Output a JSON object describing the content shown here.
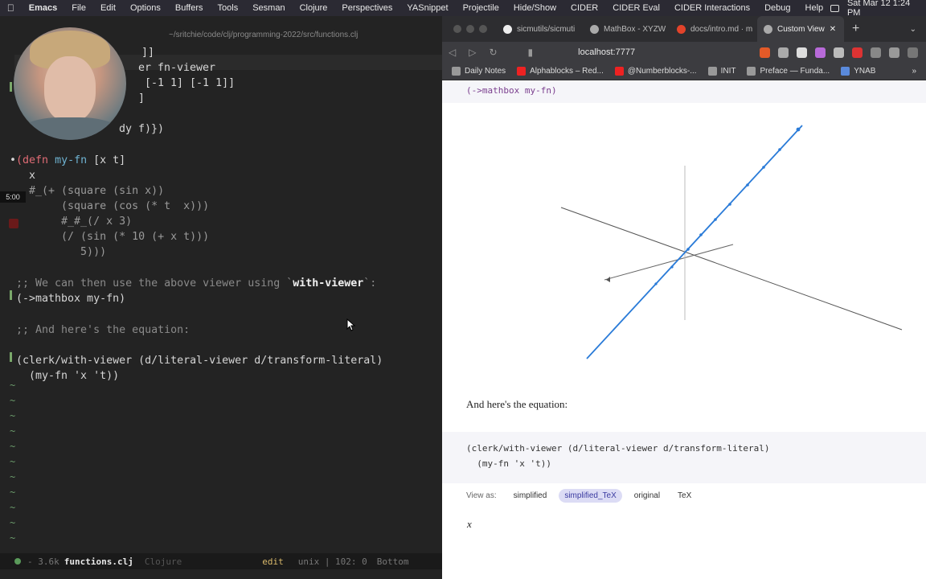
{
  "menubar": {
    "items": [
      "Emacs",
      "File",
      "Edit",
      "Options",
      "Buffers",
      "Tools",
      "Sesman",
      "Clojure",
      "Perspectives",
      "YASnippet",
      "Projectile",
      "Hide/Show",
      "CIDER",
      "CIDER Eval",
      "CIDER Interactions",
      "Debug",
      "Help"
    ],
    "clock": "Sat Mar 12  1:24 PM"
  },
  "emacs": {
    "title": "~/sritchie/code/clj/programming-2022/src/functions.clj",
    "timer": "5:00",
    "code": {
      "l0": "  ]]",
      "l1a": "er fn-viewer",
      "l2": " [-1 1] [-1 1]]",
      "l3": "]",
      "l4": "dy f)})",
      "defn_kw": "(defn",
      "defn_name": "my-fn",
      "defn_args": "[x t]",
      "x_line": "  x",
      "l7": "  #_(+ (square (sin x))",
      "l8": "       (square (cos (* t  x)))",
      "l9": "       #_#_(/ x 3)",
      "l10": "       (/ (sin (* 10 (+ x t)))",
      "l11": "          5)))",
      "comment1a": ";; We can then use the above viewer using `",
      "comment1b": "with-viewer",
      "comment1c": "`:",
      "mathbox_call": "(->mathbox my-fn)",
      "comment2": ";; And here's the equation:",
      "clerk_line": "(clerk/with-viewer (d/literal-viewer d/transform-literal)",
      "clerk_args": "  (my-fn 'x 't))"
    },
    "modeline": {
      "size": "- 3.6k",
      "filename": "functions.clj",
      "mode": "Clojure",
      "state": "edit",
      "encoding": "unix | 102: 0",
      "position": "Bottom"
    }
  },
  "browser": {
    "tabs": [
      "sicmutils/sicmuti",
      "MathBox - XYZW",
      "docs/intro.md · m",
      "Custom View"
    ],
    "url": "localhost:7777",
    "bookmarks": [
      "Daily Notes",
      "Alphablocks – Red...",
      "@Numberblocks-...",
      "INIT",
      "Preface — Funda...",
      "YNAB"
    ],
    "page": {
      "mathbox_code": "(->mathbox my-fn)",
      "paragraph": "And here's the equation:",
      "clerk_line": "(clerk/with-viewer (d/literal-viewer d/transform-literal)",
      "clerk_args": "  (my-fn 'x 't))",
      "view_as_label": "View as:",
      "view_options": [
        "simplified",
        "simplified_TeX",
        "original",
        "TeX"
      ],
      "selected_view": "simplified_TeX",
      "result": "x"
    }
  },
  "colors": {
    "emacs_bg": "#232323",
    "keyword": "#e06c75",
    "function": "#6fb3d2",
    "comment": "#8a8a8a",
    "plot_line": "#2a7bd8",
    "selected_pill": "#dcdcf5"
  }
}
